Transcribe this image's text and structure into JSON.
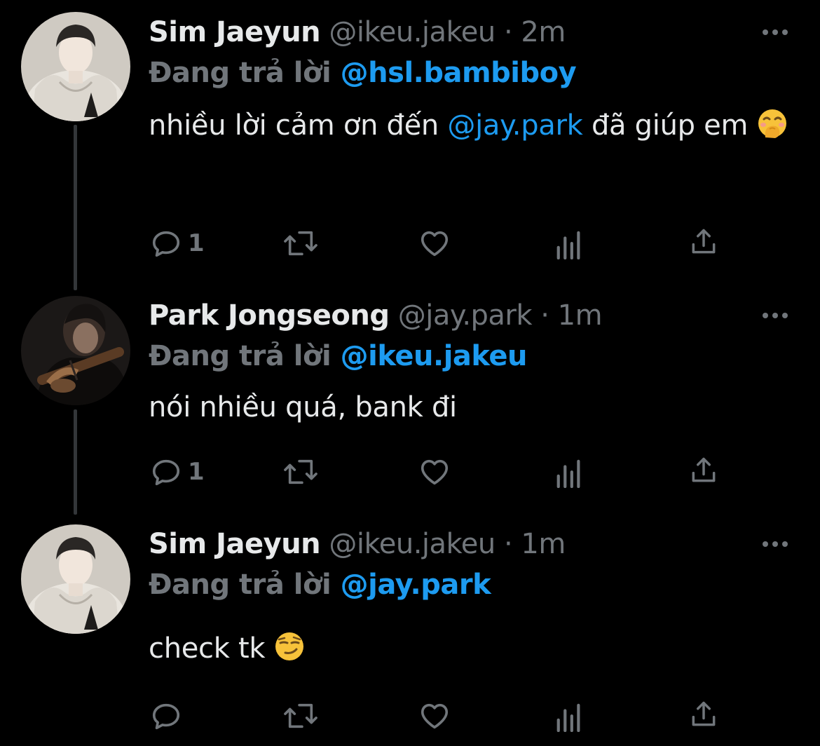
{
  "colors": {
    "background": "#000000",
    "text": "#e7e9ea",
    "muted": "#71767b",
    "mention": "#1d9bf0",
    "thread_line": "#333639"
  },
  "tweets": [
    {
      "author_name": "Sim Jaeyun",
      "meta": "@ikeu.jakeu · 2m",
      "reply_prefix": "Đang trả lời",
      "reply_to": "@hsl.bambiboy",
      "text_before": "nhiều lời cảm ơn đến",
      "text_mention": "@jay.park",
      "text_after": "đã giúp em",
      "emoji": "face-with-hand-over-mouth-emoji",
      "reply_count": "1"
    },
    {
      "author_name": "Park Jongseong",
      "meta": "@jay.park · 1m",
      "reply_prefix": "Đang trả lời",
      "reply_to": "@ikeu.jakeu",
      "text": "nói nhiều quá, bank đi",
      "reply_count": "1"
    },
    {
      "author_name": "Sim Jaeyun",
      "meta": "@ikeu.jakeu · 1m",
      "reply_prefix": "Đang trả lời",
      "reply_to": "@jay.park",
      "text": "check tk",
      "emoji": "smirking-face-emoji",
      "reply_count": ""
    }
  ],
  "icons": [
    "reply-icon",
    "retweet-icon",
    "like-icon",
    "views-icon",
    "share-icon",
    "more-icon"
  ]
}
